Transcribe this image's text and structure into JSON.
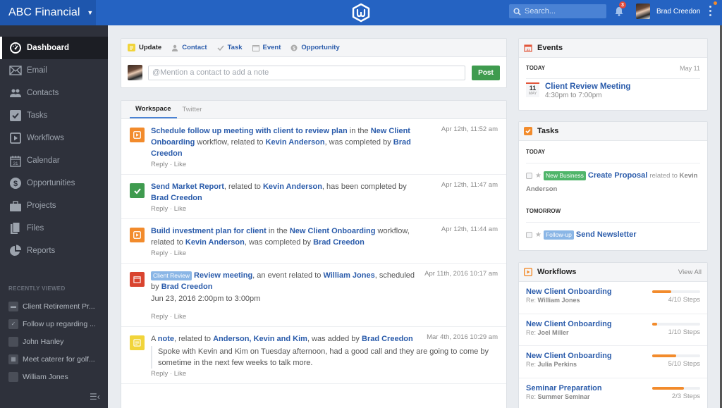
{
  "app": {
    "org_name": "ABC Financial",
    "search_placeholder": "Search...",
    "notification_count": "3",
    "user_name": "Brad Creedon"
  },
  "sidebar": {
    "items": [
      {
        "label": "Dashboard",
        "icon": "dashboard-icon",
        "active": true
      },
      {
        "label": "Email",
        "icon": "email-icon"
      },
      {
        "label": "Contacts",
        "icon": "contacts-icon"
      },
      {
        "label": "Tasks",
        "icon": "tasks-icon"
      },
      {
        "label": "Workflows",
        "icon": "workflows-icon"
      },
      {
        "label": "Calendar",
        "icon": "calendar-icon"
      },
      {
        "label": "Opportunities",
        "icon": "opportunities-icon"
      },
      {
        "label": "Projects",
        "icon": "projects-icon"
      },
      {
        "label": "Files",
        "icon": "files-icon"
      },
      {
        "label": "Reports",
        "icon": "reports-icon"
      }
    ],
    "recent_title": "RECENTLY VIEWED",
    "recent": [
      {
        "label": "Client Retirement Pr...",
        "icon": "briefcase-icon"
      },
      {
        "label": "Follow up regarding ...",
        "icon": "check-icon"
      },
      {
        "label": "John Hanley",
        "icon": "avatar"
      },
      {
        "label": "Meet caterer for golf...",
        "icon": "calendar-icon"
      },
      {
        "label": "William Jones",
        "icon": "avatar"
      }
    ]
  },
  "composer": {
    "tabs": [
      {
        "label": "Update",
        "icon": "note-icon",
        "active": true
      },
      {
        "label": "Contact",
        "icon": "person-icon"
      },
      {
        "label": "Task",
        "icon": "check-icon"
      },
      {
        "label": "Event",
        "icon": "calendar-icon"
      },
      {
        "label": "Opportunity",
        "icon": "dollar-icon"
      }
    ],
    "placeholder": "@Mention a contact to add a note",
    "post_label": "Post"
  },
  "feed": {
    "tabs": [
      {
        "label": "Workspace",
        "active": true
      },
      {
        "label": "Twitter"
      }
    ],
    "items": [
      {
        "type": "workflow",
        "parts": [
          [
            "b",
            "Schedule follow up meeting with client to review plan"
          ],
          [
            "t",
            " in the "
          ],
          [
            "b",
            "New Client Onboarding"
          ],
          [
            "t",
            " workflow, related to "
          ],
          [
            "b",
            "Kevin Anderson"
          ],
          [
            "t",
            ", was completed by "
          ],
          [
            "b",
            "Brad Creedon"
          ]
        ],
        "time": "Apr 12th, 11:52 am",
        "actions": "Reply · Like"
      },
      {
        "type": "task",
        "parts": [
          [
            "b",
            "Send Market Report"
          ],
          [
            "t",
            ", related to "
          ],
          [
            "b",
            "Kevin Anderson"
          ],
          [
            "t",
            ", has been completed by "
          ],
          [
            "b",
            "Brad Creedon"
          ]
        ],
        "time": "Apr 12th, 11:47 am",
        "actions": "Reply · Like"
      },
      {
        "type": "workflow",
        "parts": [
          [
            "b",
            "Build investment plan for client"
          ],
          [
            "t",
            " in the "
          ],
          [
            "b",
            "New Client Onboarding"
          ],
          [
            "t",
            " workflow, related to "
          ],
          [
            "b",
            "Kevin Anderson"
          ],
          [
            "t",
            ", was completed by "
          ],
          [
            "b",
            "Brad Creedon"
          ]
        ],
        "time": "Apr 12th, 11:44 am",
        "actions": "Reply · Like"
      },
      {
        "type": "event",
        "label": "Client Review",
        "parts": [
          [
            "b",
            "Review meeting"
          ],
          [
            "t",
            ", an event related to "
          ],
          [
            "b",
            "William Jones"
          ],
          [
            "t",
            ", scheduled by "
          ],
          [
            "b",
            "Brad Creedon"
          ]
        ],
        "sub": "Jun 23, 2016 2:00pm to 3:00pm",
        "time": "Apr 11th, 2016 10:17 am",
        "actions": "Reply · Like"
      },
      {
        "type": "note",
        "parts": [
          [
            "t",
            "A "
          ],
          [
            "b",
            "note"
          ],
          [
            "t",
            ", related to "
          ],
          [
            "b",
            "Anderson, Kevin and Kim"
          ],
          [
            "t",
            ", was added by "
          ],
          [
            "b",
            "Brad Creedon"
          ]
        ],
        "quote": "Spoke with Kevin and Kim on Tuesday afternoon, had a good call and they are going to come by sometime in the next few weeks to talk more.",
        "time": "Mar 4th, 2016 10:29 am",
        "actions": "Reply · Like"
      }
    ]
  },
  "events": {
    "title": "Events",
    "section": "TODAY",
    "date": "May 11",
    "items": [
      {
        "day": "11",
        "month": "MAY",
        "title": "Client Review Meeting",
        "time": "4:30pm to 7:00pm"
      }
    ]
  },
  "tasks": {
    "title": "Tasks",
    "sections": [
      {
        "label": "TODAY",
        "items": [
          {
            "tag": "New Business",
            "tag_color": "#4fb56a",
            "title": "Create Proposal",
            "rel_text": "related to",
            "rel_name": "Kevin Anderson"
          }
        ]
      },
      {
        "label": "TOMORROW",
        "items": [
          {
            "tag": "Follow-up",
            "tag_color": "#8ab6e6",
            "title": "Send Newsletter"
          }
        ]
      }
    ]
  },
  "workflows": {
    "title": "Workflows",
    "view_all": "View All",
    "items": [
      {
        "title": "New Client Onboarding",
        "re": "William Jones",
        "done": 4,
        "total": 10,
        "steps": "4/10 Steps"
      },
      {
        "title": "New Client Onboarding",
        "re": "Joel Miller",
        "done": 1,
        "total": 10,
        "steps": "1/10 Steps"
      },
      {
        "title": "New Client Onboarding",
        "re": "Julia Perkins",
        "done": 5,
        "total": 10,
        "steps": "5/10 Steps"
      },
      {
        "title": "Seminar Preparation",
        "re": "Summer Seminar",
        "done": 2,
        "total": 3,
        "steps": "2/3 Steps"
      }
    ],
    "re_prefix": "Re:"
  },
  "colors": {
    "brand": "#2563c2",
    "link": "#2b5cab",
    "accent_orange": "#f28b2c",
    "success": "#3f9b4f"
  }
}
